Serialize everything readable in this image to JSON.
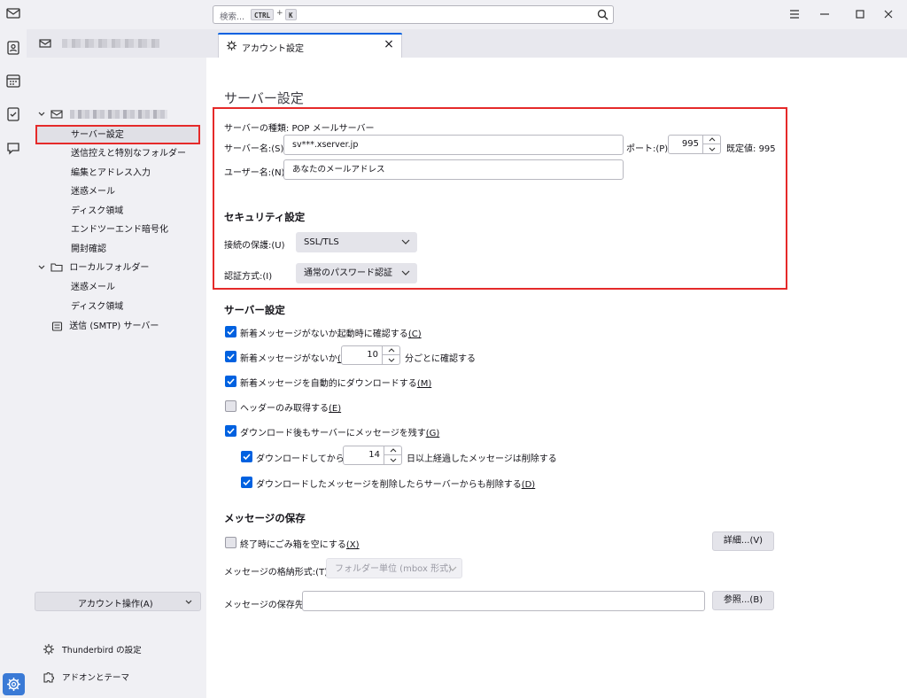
{
  "search": {
    "placeholder": "検索...",
    "shortcut_ctrl": "CTRL",
    "shortcut_plus": "+",
    "shortcut_key": "K"
  },
  "tabs": {
    "account_tab_label": "アカウント設定",
    "close": "×"
  },
  "sidebar": {
    "server_settings": "サーバー設定",
    "items": [
      "送信控えと特別なフォルダー",
      "編集とアドレス入力",
      "迷惑メール",
      "ディスク領域",
      "エンドツーエンド暗号化",
      "開封確認"
    ],
    "local_folders": "ローカルフォルダー",
    "local_items": [
      "迷惑メール",
      "ディスク領域"
    ],
    "smtp": "送信 (SMTP) サーバー",
    "account_actions": "アカウント操作(A)",
    "thunderbird_settings": "Thunderbird の設定",
    "addons": "アドオンとテーマ"
  },
  "page": {
    "title": "サーバー設定",
    "server_type_label": "サーバーの種類:",
    "server_type_value": "POP メールサーバー",
    "server_name_label": "サーバー名:(S)",
    "server_name_value": "sv***.xserver.jp",
    "port_label": "ポート:(P)",
    "port_value": "995",
    "default_label": "既定値:",
    "default_value": "995",
    "username_label": "ユーザー名:(N)",
    "username_value": "あなたのメールアドレス",
    "security_heading": "セキュリティ設定",
    "connection_label": "接続の保護:(U)",
    "connection_value": "SSL/TLS",
    "auth_label": "認証方式:(I)",
    "auth_value": "通常のパスワード認証",
    "server_section": "サーバー設定",
    "check_startup": {
      "text": "新着メッセージがないか起動時に確認する",
      "key": "(C)",
      "checked": true
    },
    "check_every_prefix": {
      "text": "新着メッセージがないか",
      "key": "(Y)",
      "checked": true
    },
    "check_every_value": "10",
    "check_every_suffix": "分ごとに確認する",
    "auto_download": {
      "text": "新着メッセージを自動的にダウンロードする",
      "key": "(M)",
      "checked": true
    },
    "headers_only": {
      "text": "ヘッダーのみ取得する",
      "key": "(E)",
      "checked": false
    },
    "leave_on_server": {
      "text": "ダウンロード後もサーバーにメッセージを残す",
      "key": "(G)",
      "checked": true
    },
    "delete_after_prefix": {
      "text": "ダウンロードしてから",
      "key": "(O)",
      "checked": true
    },
    "delete_after_value": "14",
    "delete_after_suffix": "日以上経過したメッセージは削除する",
    "delete_when_deleted": {
      "text": "ダウンロードしたメッセージを削除したらサーバーからも削除する",
      "key": "(D)",
      "checked": true
    },
    "storage_heading": "メッセージの保存",
    "empty_trash": {
      "text": "終了時にごみ箱を空にする",
      "key": "(X)",
      "checked": false
    },
    "advanced_button": "詳細...(V)",
    "store_type_label": "メッセージの格納形式:(T)",
    "store_type_value": "フォルダー単位 (mbox 形式)",
    "local_dir_label": "メッセージの保存先:",
    "local_dir_value": "",
    "browse_button": "参照...(B)"
  }
}
